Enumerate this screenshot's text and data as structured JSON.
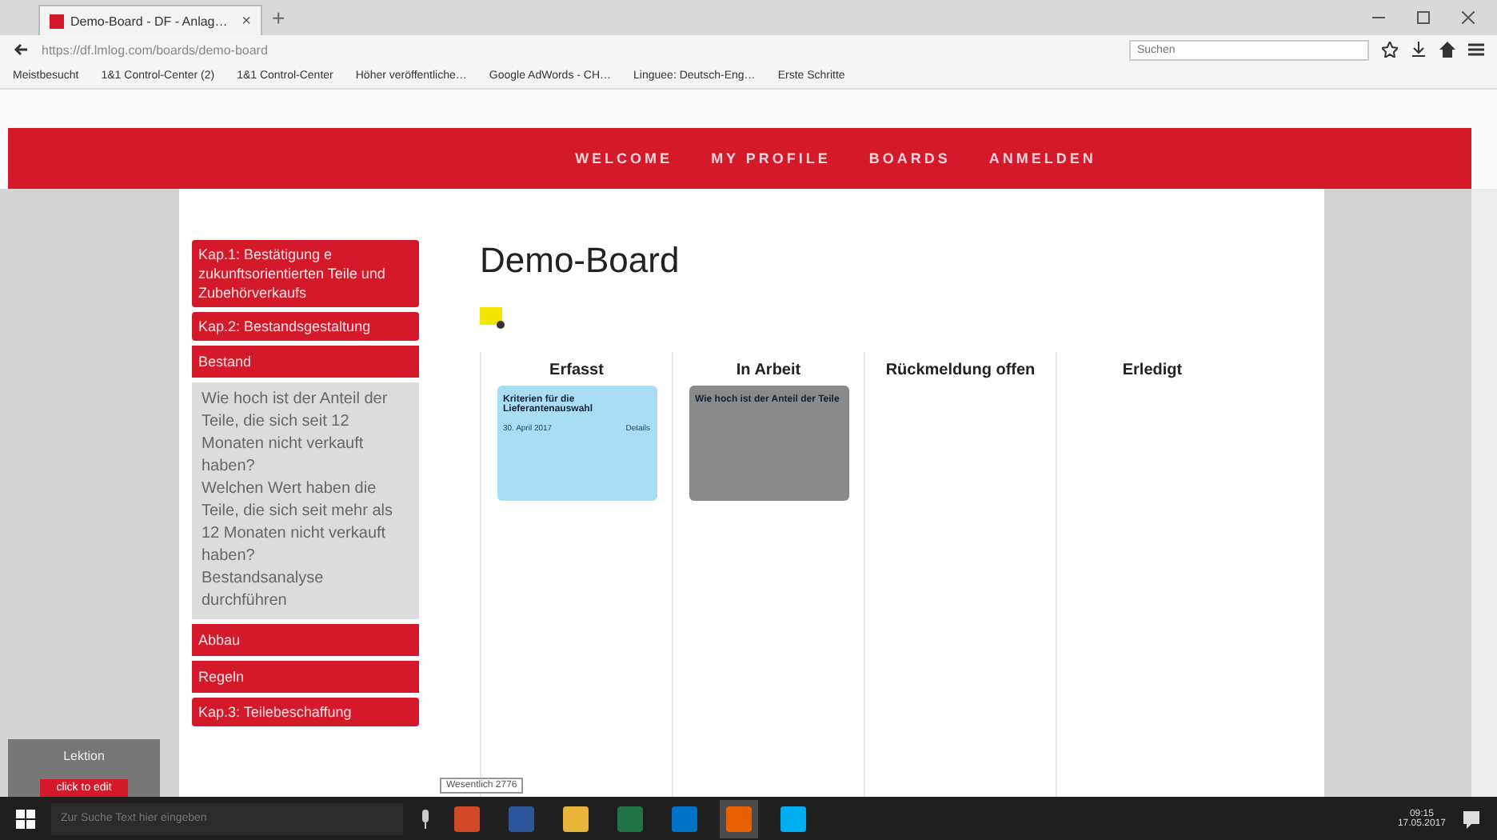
{
  "browser": {
    "tab": {
      "title": "Demo-Board - DF - Anlag…",
      "close": "×"
    },
    "new_tab": "+",
    "address": "https://df.lmlog.com/boards/demo-board",
    "search": {
      "placeholder": "Suchen"
    },
    "bookmarks": [
      "Meistbesucht",
      "1&1 Control-Center (2)",
      "1&1 Control-Center",
      "Höher veröffentliche…",
      "Google AdWords - CH…",
      "Linguee: Deutsch-Eng…",
      "Erste Schritte"
    ]
  },
  "nav": {
    "items": [
      {
        "label": "WELCOME"
      },
      {
        "label": "MY PROFILE"
      },
      {
        "label": "BOARDS"
      },
      {
        "label": "ANMELDEN"
      }
    ]
  },
  "sidebar": {
    "items": [
      {
        "label": "Kap.1: Bestätigung e zukunftsorientierten Teile und Zubehörverkaufs",
        "kind": "chapter"
      },
      {
        "label": "Kap.2: Bestandsgestaltung",
        "kind": "chapter",
        "children": [
          {
            "label": "Bestand",
            "kind": "topic",
            "children": [
              {
                "label": "Wie hoch ist der Anteil der Teile, die sich seit 12 Monaten nicht verkauft haben?"
              },
              {
                "label": "Welchen Wert haben die Teile, die sich seit mehr als 12 Monaten nicht verkauft haben?"
              },
              {
                "label": "Bestandsanalyse durchführen"
              }
            ]
          },
          {
            "label": "Abbau",
            "kind": "topic"
          },
          {
            "label": "Regeln",
            "kind": "topic"
          }
        ]
      },
      {
        "label": "Kap.3: Teilebeschaffung",
        "kind": "chapter"
      }
    ]
  },
  "board": {
    "title": "Demo-Board",
    "columns": [
      {
        "title": "Erfasst",
        "cards": [
          {
            "title": "Kriterien für die Lieferantenauswahl",
            "date": "30. April 2017",
            "link": "Details",
            "color": "#a9dcf5"
          }
        ]
      },
      {
        "title": "In Arbeit",
        "cards": [
          {
            "title": "Wie hoch ist der Anteil der Teile",
            "color": "#8a8a8a"
          }
        ]
      },
      {
        "title": "Rückmeldung offen"
      },
      {
        "title": "Erledigt"
      }
    ]
  },
  "lesson": {
    "label": "Lektion",
    "button": "click to edit"
  },
  "tooltip": "Wesentlich 2776",
  "taskbar": {
    "search": {
      "placeholder": "Zur Suche Text hier eingeben"
    },
    "apps": [
      {
        "color": "#d24726",
        "selected": false
      },
      {
        "color": "#2b579a",
        "selected": false
      },
      {
        "color": "#e8b43a",
        "selected": false
      },
      {
        "color": "#217346",
        "selected": false
      },
      {
        "color": "#0072c6",
        "selected": false
      },
      {
        "color": "#e66000",
        "selected": true
      },
      {
        "color": "#00aff0",
        "selected": false
      }
    ],
    "time": "09:15",
    "date": "17.05.2017"
  }
}
